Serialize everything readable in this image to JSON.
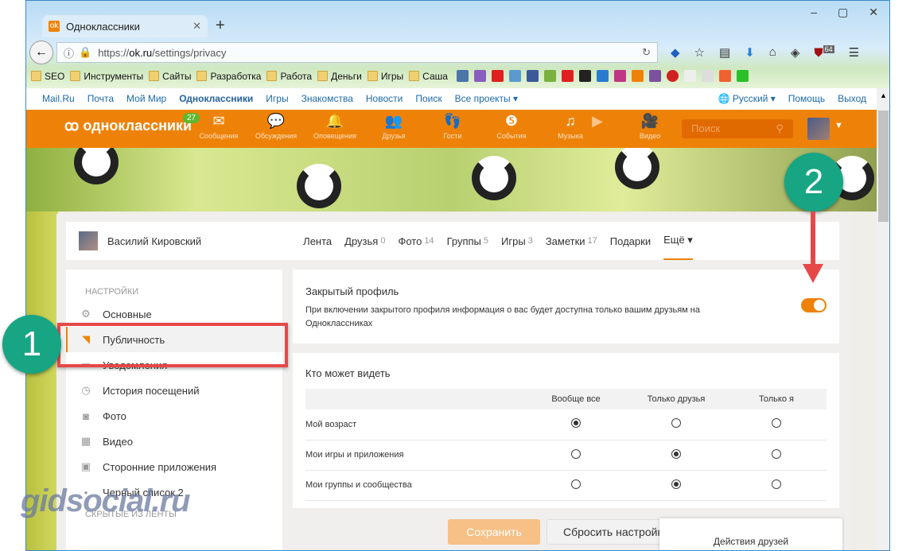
{
  "browser": {
    "tab_title": "Одноклассники",
    "url_prefix": "https://",
    "url_domain": "ok.ru",
    "url_path": "/settings/privacy",
    "ublock_count": "64",
    "bookmarks": [
      "SEO",
      "Инструменты",
      "Сайты",
      "Разработка",
      "Работа",
      "Деньги",
      "Игры",
      "Саша"
    ]
  },
  "mailbar": {
    "links": [
      "Mail.Ru",
      "Почта",
      "Мой Мир",
      "Одноклассники",
      "Игры",
      "Знакомства",
      "Новости",
      "Поиск",
      "Все проекты ▾"
    ],
    "language": "Русский ▾",
    "help": "Помощь",
    "logout": "Выход"
  },
  "header": {
    "logo": "одноклассники",
    "badge": "27",
    "search_placeholder": "Поиск",
    "nav": [
      "Сообщения",
      "Обсуждения",
      "Оповещения",
      "Друзья",
      "Гости",
      "События",
      "Музыка",
      "Видео"
    ]
  },
  "profile": {
    "name": "Василий Кировский",
    "tabs": [
      {
        "label": "Лента",
        "count": ""
      },
      {
        "label": "Друзья",
        "count": "0"
      },
      {
        "label": "Фото",
        "count": "14"
      },
      {
        "label": "Группы",
        "count": "5"
      },
      {
        "label": "Игры",
        "count": "3"
      },
      {
        "label": "Заметки",
        "count": "17"
      },
      {
        "label": "Подарки",
        "count": ""
      },
      {
        "label": "Ещё ▾",
        "count": ""
      }
    ]
  },
  "sidebar": {
    "heading": "НАСТРОЙКИ",
    "items": [
      "Основные",
      "Публичность",
      "Уведомления",
      "История посещений",
      "Фото",
      "Видео",
      "Сторонние приложения",
      "Черный список 2"
    ],
    "heading2": "СКРЫТЫЕ ИЗ ЛЕНТЫ"
  },
  "closed_profile": {
    "title": "Закрытый профиль",
    "description": "При включении закрытого профиля информация о вас будет доступна только вашим друзьям на Одноклассниках",
    "enabled": true
  },
  "visibility": {
    "title": "Кто может видеть",
    "columns": [
      "Вообще все",
      "Только друзья",
      "Только я"
    ],
    "rows": [
      {
        "label": "Мой возраст",
        "selected": 0
      },
      {
        "label": "Мои игры и приложения",
        "selected": 1
      },
      {
        "label": "Мои группы и сообщества",
        "selected": 1
      }
    ]
  },
  "buttons": {
    "save": "Сохранить",
    "reset": "Сбросить настройки"
  },
  "popup": {
    "label": "Действия друзей"
  },
  "annotations": {
    "step1": "1",
    "step2": "2",
    "watermark": "gidsocial.ru"
  },
  "colors": {
    "accent": "#ee8208",
    "callout": "#17a584",
    "highlight": "#e64848"
  }
}
